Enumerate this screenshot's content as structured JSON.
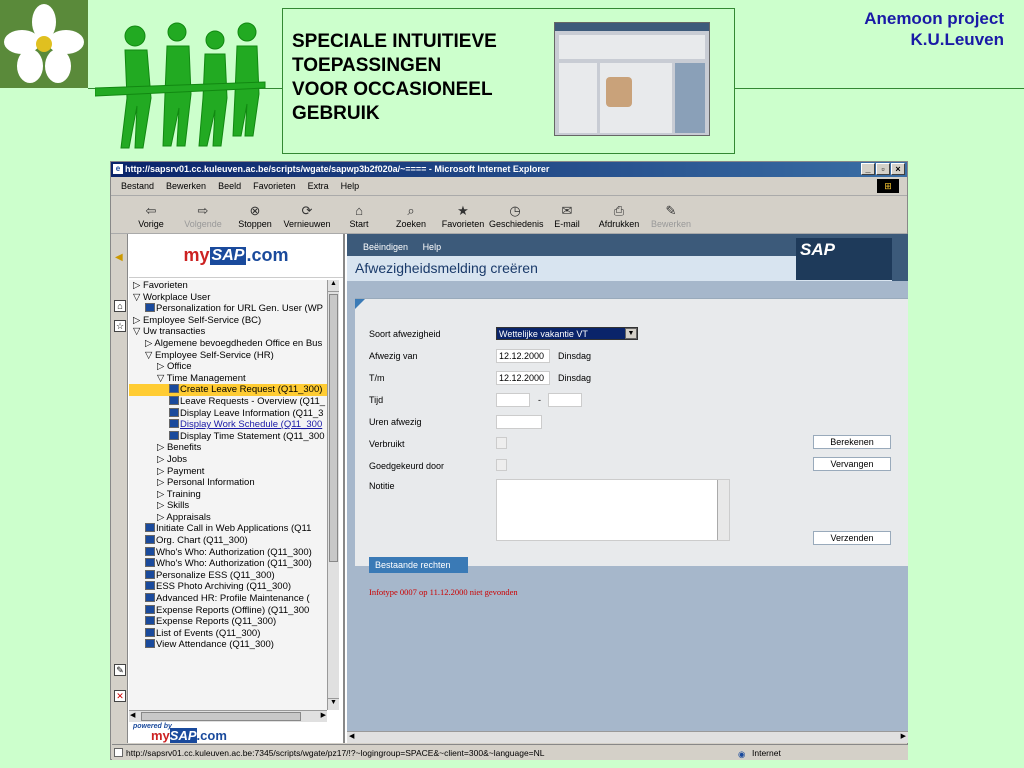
{
  "slide": {
    "title_lines": [
      "SPECIALE INTUITIEVE",
      "TOEPASSINGEN",
      "VOOR OCCASIONEEL",
      "GEBRUIK"
    ],
    "brand_lines": [
      "Anemoon project",
      "K.U.Leuven"
    ]
  },
  "browser": {
    "title": "http://sapsrv01.cc.kuleuven.ac.be/scripts/wgate/sapwp3b2f020a/~==== - Microsoft Internet Explorer",
    "menu": [
      "Bestand",
      "Bewerken",
      "Beeld",
      "Favorieten",
      "Extra",
      "Help"
    ],
    "toolbar": [
      {
        "label": "Vorige",
        "icon": "back-arrow-icon",
        "enabled": true
      },
      {
        "label": "Volgende",
        "icon": "forward-arrow-icon",
        "enabled": false
      },
      {
        "label": "Stoppen",
        "icon": "stop-icon",
        "enabled": true
      },
      {
        "label": "Vernieuwen",
        "icon": "refresh-icon",
        "enabled": true
      },
      {
        "label": "Start",
        "icon": "home-icon",
        "enabled": true
      },
      {
        "label": "Zoeken",
        "icon": "search-icon",
        "enabled": true
      },
      {
        "label": "Favorieten",
        "icon": "favorites-icon",
        "enabled": true
      },
      {
        "label": "Geschiedenis",
        "icon": "history-icon",
        "enabled": true
      },
      {
        "label": "E-mail",
        "icon": "mail-icon",
        "enabled": true
      },
      {
        "label": "Afdrukken",
        "icon": "print-icon",
        "enabled": true
      },
      {
        "label": "Bewerken",
        "icon": "edit-icon",
        "enabled": false
      }
    ],
    "status_url": "http://sapsrv01.cc.kuleuven.ac.be:7345/scripts/wgate/pz17/!?~logingroup=SPACE&~client=300&~language=NL",
    "zone": "Internet"
  },
  "portal": {
    "logo": {
      "my": "my",
      "sap": "SAP",
      "com": ".com"
    },
    "powered_by": "powered by",
    "tree": [
      {
        "text": "Favorieten",
        "type": "folder-closed",
        "indent": 0
      },
      {
        "text": "Workplace User",
        "type": "folder-open",
        "indent": 0
      },
      {
        "text": "Personalization for URL Gen. User (WP",
        "type": "item",
        "indent": 1
      },
      {
        "text": "Employee Self-Service (BC)",
        "type": "folder-closed",
        "indent": 0
      },
      {
        "text": "Uw transacties",
        "type": "folder-open",
        "indent": 0
      },
      {
        "text": "Algemene bevoegdheden Office en Bus",
        "type": "folder-closed",
        "indent": 1
      },
      {
        "text": "Employee Self-Service (HR)",
        "type": "folder-open",
        "indent": 1
      },
      {
        "text": "Office",
        "type": "folder-closed",
        "indent": 2
      },
      {
        "text": "Time Management",
        "type": "folder-open",
        "indent": 2
      },
      {
        "text": "Create Leave Request (Q11_300)",
        "type": "item-selected",
        "indent": 3
      },
      {
        "text": "Leave Requests - Overview (Q11_",
        "type": "item",
        "indent": 3
      },
      {
        "text": "Display Leave Information (Q11_3",
        "type": "item",
        "indent": 3
      },
      {
        "text": "Display Work Schedule (Q11_300",
        "type": "item-link",
        "indent": 3
      },
      {
        "text": "Display Time Statement (Q11_300",
        "type": "item",
        "indent": 3
      },
      {
        "text": "Benefits",
        "type": "folder-closed",
        "indent": 2
      },
      {
        "text": "Jobs",
        "type": "folder-closed",
        "indent": 2
      },
      {
        "text": "Payment",
        "type": "folder-closed",
        "indent": 2
      },
      {
        "text": "Personal Information",
        "type": "folder-closed",
        "indent": 2
      },
      {
        "text": "Training",
        "type": "folder-closed",
        "indent": 2
      },
      {
        "text": "Skills",
        "type": "folder-closed",
        "indent": 2
      },
      {
        "text": "Appraisals",
        "type": "folder-closed",
        "indent": 2
      },
      {
        "text": "Initiate Call in Web Applications (Q11",
        "type": "item",
        "indent": 1
      },
      {
        "text": "Org. Chart (Q11_300)",
        "type": "item",
        "indent": 1
      },
      {
        "text": "Who's Who: Authorization (Q11_300)",
        "type": "item",
        "indent": 1
      },
      {
        "text": "Who's Who: Authorization (Q11_300)",
        "type": "item",
        "indent": 1
      },
      {
        "text": "Personalize ESS (Q11_300)",
        "type": "item",
        "indent": 1
      },
      {
        "text": "ESS Photo Archiving (Q11_300)",
        "type": "item",
        "indent": 1
      },
      {
        "text": "Advanced HR: Profile Maintenance (",
        "type": "item",
        "indent": 1
      },
      {
        "text": "Expense Reports (Offline) (Q11_300",
        "type": "item",
        "indent": 1
      },
      {
        "text": "Expense Reports (Q11_300)",
        "type": "item",
        "indent": 1
      },
      {
        "text": "List of Events (Q11_300)",
        "type": "item",
        "indent": 1
      },
      {
        "text": "View Attendance (Q11_300)",
        "type": "item",
        "indent": 1
      }
    ]
  },
  "app": {
    "menu": [
      "Beëindigen",
      "Help"
    ],
    "title": "Afwezigheidsmelding creëren",
    "sap_logo": "SAP",
    "labels": {
      "soort": "Soort afwezigheid",
      "van": "Afwezig van",
      "tm": "T/m",
      "tijd": "Tijd",
      "uren": "Uren afwezig",
      "verbruikt": "Verbruikt",
      "goedgekeurd": "Goedgekeurd door",
      "notitie": "Notitie"
    },
    "values": {
      "soort": "Wettelijke vakantie VT",
      "van_date": "12.12.2000",
      "van_day": "Dinsdag",
      "tm_date": "12.12.2000",
      "tm_day": "Dinsdag",
      "tijd_sep": "-"
    },
    "buttons": {
      "berekenen": "Berekenen",
      "vervangen": "Vervangen",
      "verzenden": "Verzenden",
      "bestaande": "Bestaande rechten"
    },
    "message": "Infotype 0007 op 11.12.2000 niet gevonden"
  }
}
